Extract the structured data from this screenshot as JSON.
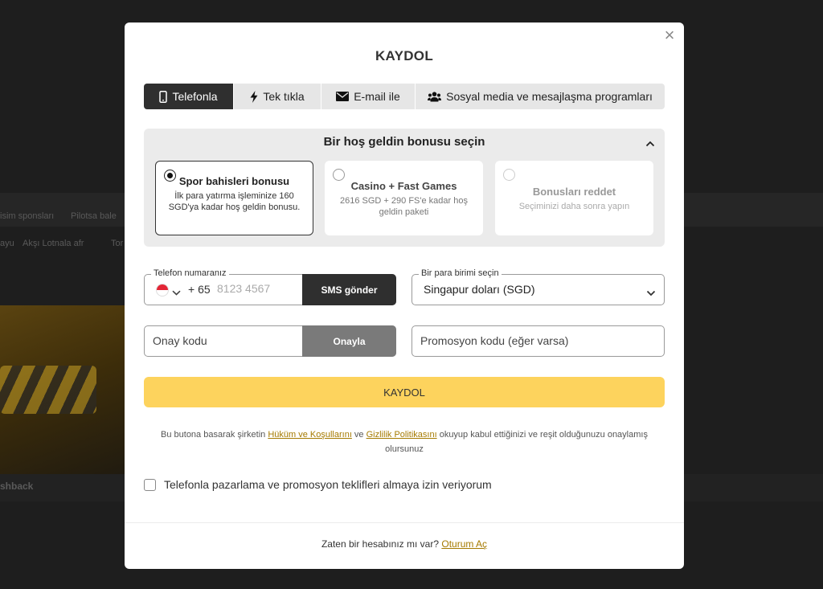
{
  "background": {
    "links": [
      "isim sponsları",
      "Pilotsa bale"
    ],
    "links2": [
      "ayu",
      "Akşı Lotnala afr",
      "Tor"
    ],
    "caption": "shback"
  },
  "modal": {
    "title": "KAYDOL",
    "close_label": "×"
  },
  "tabs": [
    {
      "label": "Telefonla",
      "icon": "phone-icon",
      "active": true
    },
    {
      "label": "Tek tıkla",
      "icon": "bolt-icon",
      "active": false
    },
    {
      "label": "E-mail ile",
      "icon": "envelope-icon",
      "active": false
    },
    {
      "label": "Sosyal media ve mesajlaşma programları",
      "icon": "users-icon",
      "active": false
    }
  ],
  "bonus": {
    "title": "Bir hoş geldin bonusu seçin",
    "options": [
      {
        "title": "Spor bahisleri bonusu",
        "desc": "İlk para yatırma işleminize 160 SGD'ya kadar hoş geldin bonusu.",
        "selected": true
      },
      {
        "title": "Casino + Fast Games",
        "desc": "2616 SGD + 290 FS'e kadar hoş geldin paketi",
        "selected": false
      },
      {
        "title": "Bonusları reddet",
        "desc": "Seçiminizi daha sonra yapın",
        "selected": false
      }
    ]
  },
  "phone": {
    "legend": "Telefon numaranız",
    "country_code": "+ 65",
    "placeholder": "8123 4567",
    "sms_button": "SMS gönder"
  },
  "currency": {
    "legend": "Bir para birimi seçin",
    "value": "Singapur doları (SGD)"
  },
  "confirm": {
    "placeholder": "Onay kodu",
    "button": "Onayla"
  },
  "promo": {
    "placeholder": "Promosyon kodu (eğer varsa)"
  },
  "submit_label": "KAYDOL",
  "terms": {
    "before": "Bu butona basarak şirketin ",
    "link1": "Hüküm ve Koşullarını",
    "middle": " ve ",
    "link2": "Gizlilik Politikasını",
    "after": " okuyup kabul ettiğinizi ve reşit olduğunuzu onaylamış olursunuz"
  },
  "marketing_consent": {
    "label": "Telefonla pazarlama ve promosyon teklifleri almaya izin veriyorum",
    "checked": false
  },
  "login": {
    "text": "Zaten bir hesabınız mı var? ",
    "link": "Oturum Aç"
  },
  "colors": {
    "accent_yellow": "#fdd35d",
    "link_gold": "#a57a00",
    "dark": "#2f2f2f"
  }
}
